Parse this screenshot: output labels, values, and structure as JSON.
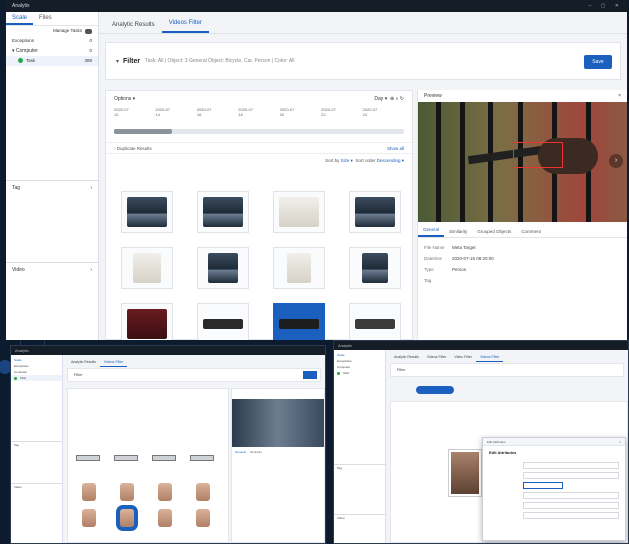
{
  "app": {
    "title": "Analytix"
  },
  "sidebar": {
    "tabs": [
      "Scale",
      "Files"
    ],
    "actions_label": "Manage Tasks",
    "items": [
      {
        "label": "Exceptions",
        "count": "0"
      },
      {
        "label": "Computer",
        "count": "0"
      },
      {
        "label": "Task",
        "count": "389"
      }
    ],
    "tag_section": "Tag",
    "video_section": "Video"
  },
  "main_tabs": [
    "Analytic Results",
    "Videos Filter"
  ],
  "filter": {
    "label": "Filter",
    "text": "Task: All | Object: 3 General Object: Bicycle, Car, Person | Color: All",
    "save_label": "Save"
  },
  "toolbar": {
    "view_label": "Options",
    "unit_label": "Day"
  },
  "timeline": [
    {
      "date": "2020-07",
      "value": "12"
    },
    {
      "date": "2020-07",
      "value": "14"
    },
    {
      "date": "2020-07",
      "value": "16"
    },
    {
      "date": "2020-07",
      "value": "18"
    },
    {
      "date": "2020-07",
      "value": "20"
    },
    {
      "date": "2020-07",
      "value": "22"
    },
    {
      "date": "2020-07",
      "value": "24"
    }
  ],
  "timeline_progress": 0.2,
  "duplicates": {
    "label": "Duplicate Results",
    "action": "Show all"
  },
  "sort": {
    "label": "Sort by",
    "value": "Size",
    "order_label": "Sort order",
    "order_value": "Descending"
  },
  "preview": {
    "title": "Preview",
    "tabs": [
      "General",
      "Similarity",
      "Grouped Objects",
      "Comment"
    ],
    "fields": [
      {
        "key": "File Name",
        "value": "Meta Target"
      },
      {
        "key": "Datetime",
        "value": "2020-07-16 08:20:00"
      },
      {
        "key": "Type",
        "value": "Person"
      },
      {
        "key": "Tag",
        "value": ""
      }
    ]
  },
  "mini_right": {
    "tabs": [
      "Analytic Results",
      "Videos Filter",
      "Video Filter",
      "Videos Filter"
    ],
    "modal_title": "Edit Attributes",
    "modal_subtitle": "Edit Attributes"
  }
}
